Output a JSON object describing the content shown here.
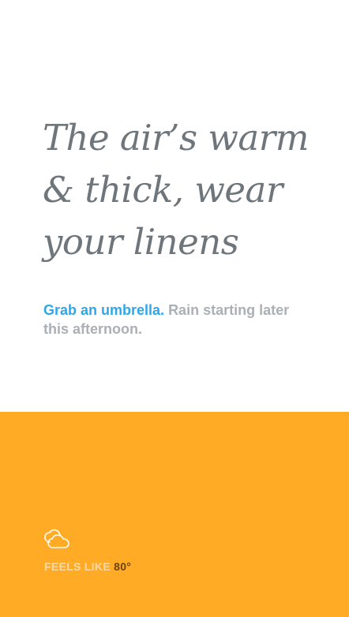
{
  "headline": {
    "lines": [
      "The air’s warm",
      "& thick, wear",
      "your linens"
    ]
  },
  "forecast": {
    "lead": "Grab an umbrella.",
    "detail": "Rain starting later this afternoon."
  },
  "conditions": {
    "icon": "cloud-icon",
    "feels_like_label": "FEELS LIKE",
    "feels_like_value": "80°"
  },
  "colors": {
    "headline_text": "#6e767c",
    "lead_text": "#2ea7ea",
    "detail_text": "#aab0b5",
    "bottom_panel": "#ffab25",
    "feels_label": "#ffd9a3",
    "feels_value": "#6b4300"
  }
}
